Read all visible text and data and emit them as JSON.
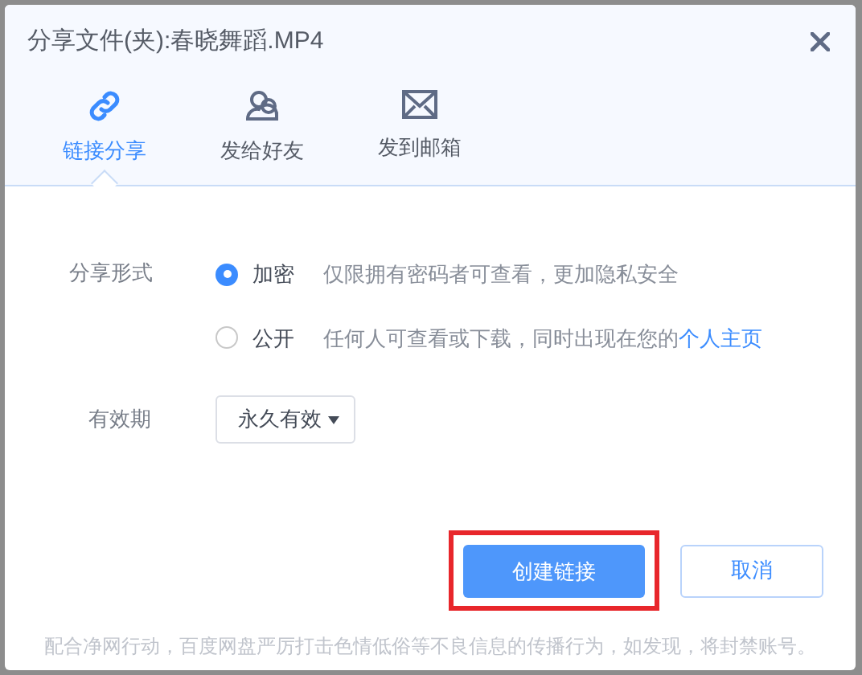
{
  "dialog": {
    "title": "分享文件(夹):春晓舞蹈.MP4"
  },
  "tabs": [
    {
      "label": "链接分享",
      "kind": "link",
      "selected": true
    },
    {
      "label": "发给好友",
      "kind": "friends",
      "selected": false
    },
    {
      "label": "发到邮箱",
      "kind": "mail",
      "selected": false
    }
  ],
  "share_form": {
    "label": "分享形式",
    "options": [
      {
        "label": "加密",
        "description": "仅限拥有密码者可查看，更加隐私安全",
        "selected": true
      },
      {
        "label": "公开",
        "description": "任何人可查看或下载，同时出现在您的",
        "link": "个人主页",
        "selected": false
      }
    ]
  },
  "validity": {
    "label": "有效期",
    "value": "永久有效"
  },
  "buttons": [
    {
      "label": "创建链接",
      "kind": "primary",
      "highlighted": true
    },
    {
      "label": "取消",
      "kind": "secondary",
      "highlighted": false
    }
  ],
  "notice": "配合净网行动，百度网盘严厉打击色情低俗等不良信息的传播行为，如发现，将封禁账号。"
}
